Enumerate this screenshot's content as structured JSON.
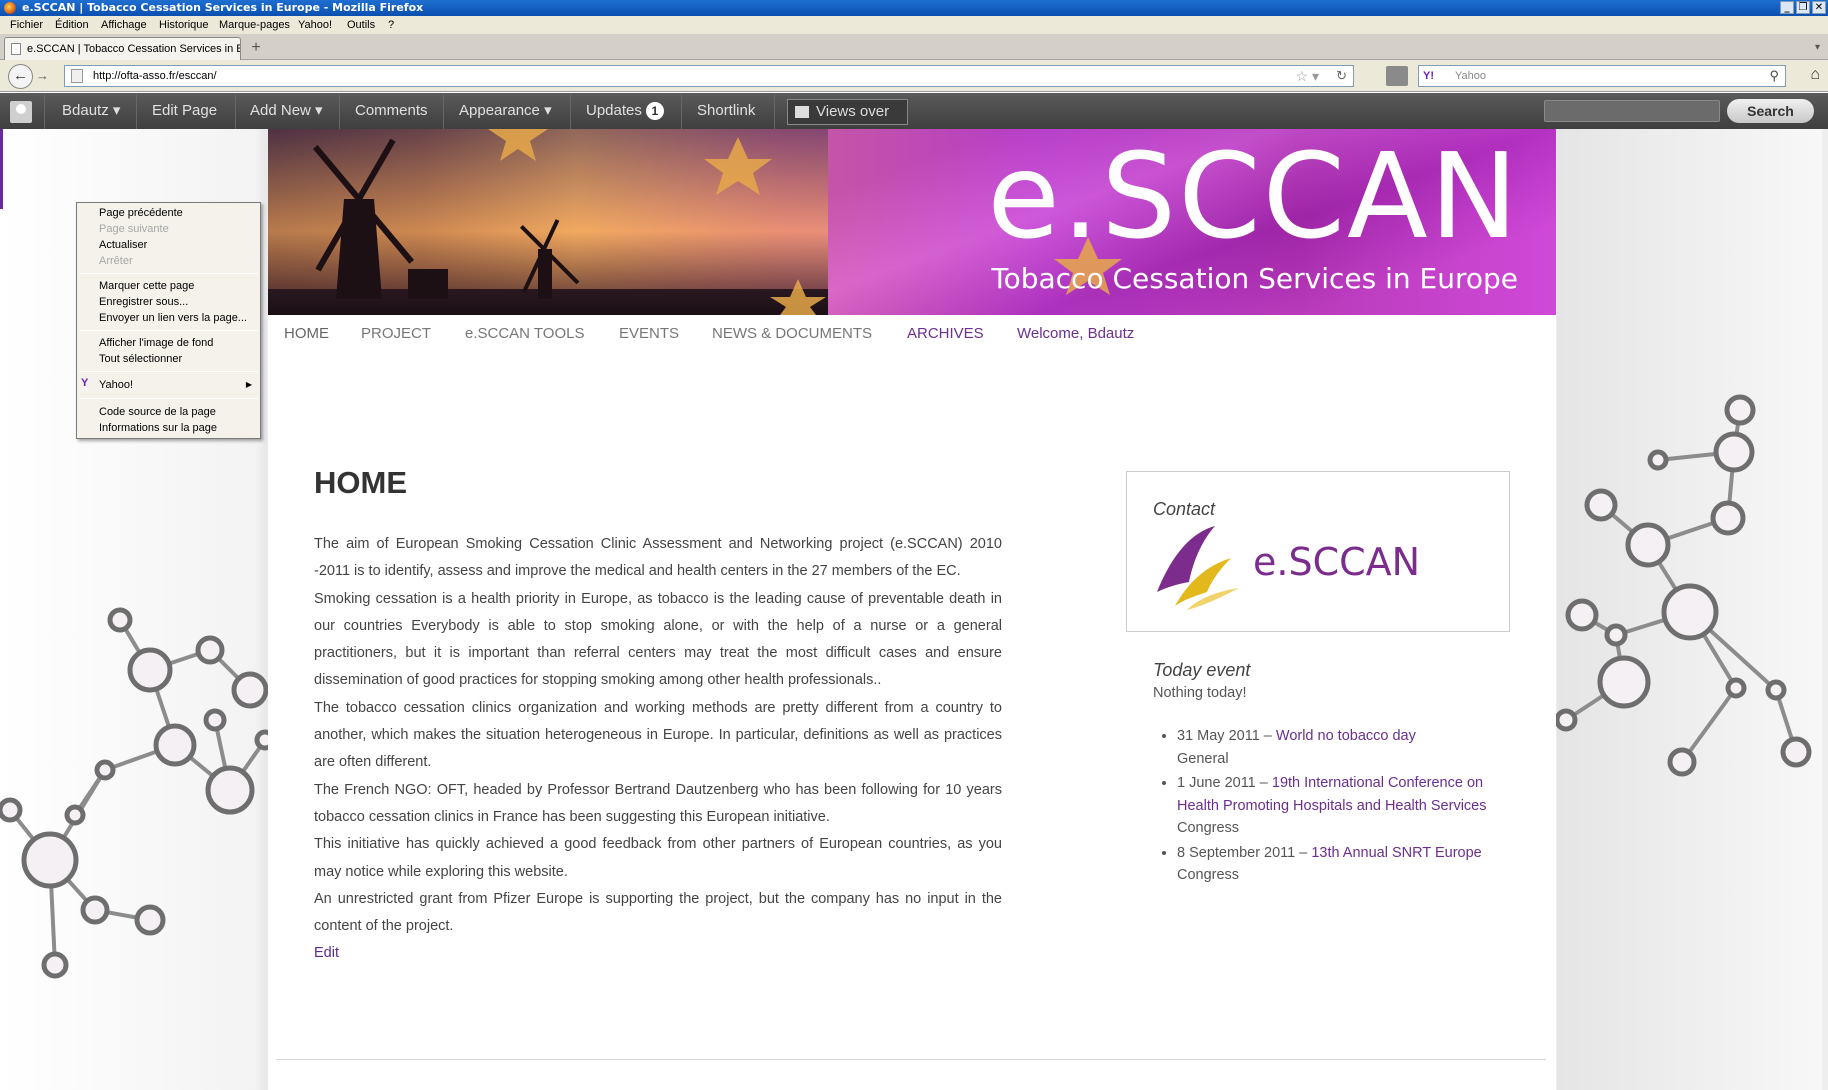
{
  "window": {
    "title": "e.SCCAN | Tobacco Cessation Services in Europe - Mozilla Firefox"
  },
  "menubar": {
    "items": [
      "Fichier",
      "Édition",
      "Affichage",
      "Historique",
      "Marque-pages",
      "Yahoo!",
      "Outils",
      "?"
    ]
  },
  "tabs": [
    {
      "label": "e.SCCAN | Tobacco Cessation Services in Eu..."
    }
  ],
  "toolbar": {
    "url": "http://ofta-asso.fr/esccan/",
    "search_placeholder": "Yahoo",
    "search_engine": "Y!",
    "new_tab": "+"
  },
  "adminbar": {
    "user": "Bdautz ▾",
    "edit_page": "Edit Page",
    "add_new": "Add New ▾",
    "comments": "Comments",
    "appearance": "Appearance ▾",
    "updates": "Updates",
    "updates_count": "1",
    "shortlink": "Shortlink",
    "views": "Views over",
    "search_button": "Search"
  },
  "banner": {
    "title": "e.SCCAN",
    "subtitle": "Tobacco Cessation Services in Europe"
  },
  "nav": {
    "items": [
      "HOME",
      "PROJECT",
      "e.SCCAN TOOLS",
      "EVENTS",
      "NEWS & DOCUMENTS",
      "ARCHIVES",
      "Welcome, Bdautz"
    ]
  },
  "main": {
    "title": "HOME",
    "paragraphs": [
      "The aim of European Smoking Cessation Clinic Assessment and Networking project (e.SCCAN) 2010 -2011 is to identify, assess and improve the medical and health centers in the 27 members of the EC.",
      "Smoking cessation is a health priority in Europe, as tobacco is the leading cause of preventable death in our countries Everybody is able to stop smoking alone, or with the help of a nurse or a general practitioners, but it is important than referral centers may treat the most difficult cases and ensure dissemination of good practices for stopping smoking among other health professionals..",
      "The tobacco cessation clinics organization and working methods are pretty different from a country to another, which makes the situation heterogeneous in Europe. In particular, definitions as well as practices are often different.",
      "The French NGO: OFT, headed by Professor Bertrand Dautzenberg who has been following for 10 years tobacco cessation clinics in France has been suggesting this European initiative.",
      "This initiative has quickly achieved a good feedback from other partners of European countries, as you may notice while exploring this website.",
      "An unrestricted grant from Pfizer Europe is supporting the project, but the company has no input in the content of the project."
    ],
    "edit_link": "Edit"
  },
  "sidebar": {
    "contact_title": "Contact",
    "contact_logo_text": "e.SCCAN",
    "events_title": "Today event",
    "events_none": "Nothing today!",
    "events": [
      {
        "date": "31 May 2011 – ",
        "title": "World no tobacco day",
        "category": "General"
      },
      {
        "date": "1 June 2011 – ",
        "title": "19th International Conference on Health Promoting Hospitals and Health Services",
        "category": "Congress"
      },
      {
        "date": "8 September 2011 – ",
        "title": "13th Annual SNRT Europe",
        "category": "Congress"
      }
    ]
  },
  "context_menu": {
    "back": "Page précédente",
    "forward": "Page suivante",
    "reload": "Actualiser",
    "stop": "Arrêter",
    "bookmark": "Marquer cette page",
    "save_as": "Enregistrer sous...",
    "send_link": "Envoyer un lien vers la page...",
    "view_bg": "Afficher l'image de fond",
    "select_all": "Tout sélectionner",
    "yahoo": "Yahoo!",
    "view_source": "Code source de la page",
    "page_info": "Informations sur la page"
  },
  "colors": {
    "accent_purple": "#6a2f8f",
    "admin_bar": "#464646",
    "banner_magenta": "#b43cc8"
  }
}
